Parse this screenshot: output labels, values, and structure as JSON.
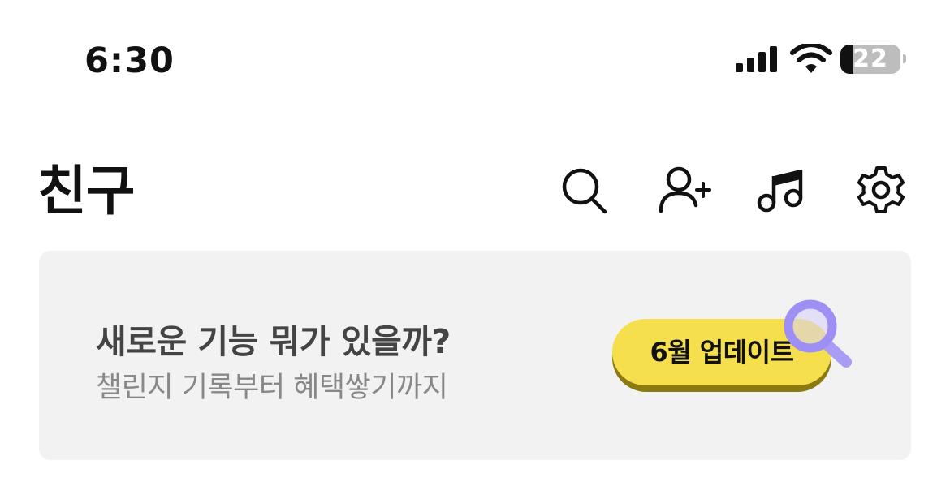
{
  "status_bar": {
    "time": "6:30",
    "battery_level": "22",
    "battery_fraction": 0.22,
    "icons": [
      "cellular-signal-icon",
      "wifi-icon",
      "battery-icon"
    ]
  },
  "header": {
    "title": "친구",
    "actions": [
      {
        "name": "search-icon"
      },
      {
        "name": "add-friend-icon"
      },
      {
        "name": "music-icon"
      },
      {
        "name": "settings-icon"
      }
    ]
  },
  "banner": {
    "title": "새로운 기능 뭐가 있을까?",
    "subtitle": "챌린지 기록부터 혜택쌓기까지",
    "button_label": "6월 업데이트",
    "colors": {
      "background": "#f2f2f2",
      "button": "#f5df4d",
      "magnifier": "#a99cf5"
    }
  }
}
